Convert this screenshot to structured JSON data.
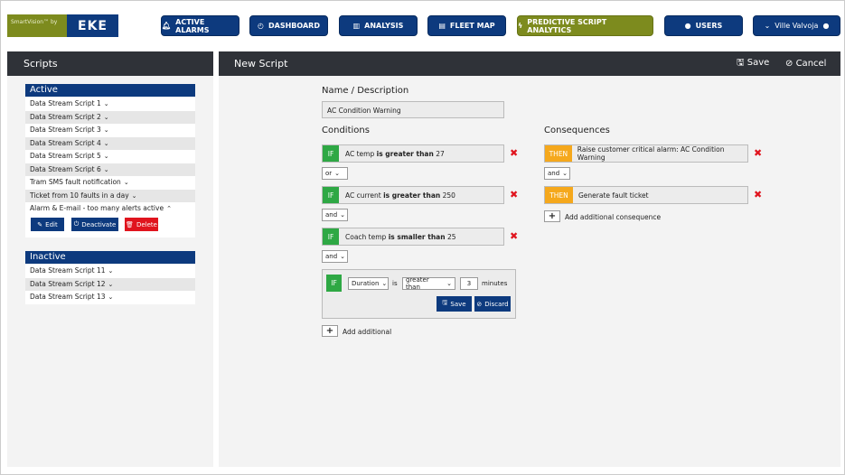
{
  "logo": {
    "brand": "SmartVision™ by",
    "company": "EKE",
    "colors": {
      "olive": "#7d8b1e",
      "blue": "#0d3a7e"
    }
  },
  "nav": [
    {
      "label": "ACTIVE ALARMS",
      "icon": "bell-icon"
    },
    {
      "label": "DASHBOARD",
      "icon": "gauge-icon"
    },
    {
      "label": "ANALYSIS",
      "icon": "bar-chart-icon"
    },
    {
      "label": "FLEET MAP",
      "icon": "map-icon"
    },
    {
      "label": "PREDICTIVE SCRIPT ANALYTICS",
      "icon": "bolt-icon",
      "active": true
    },
    {
      "label": "USERS",
      "icon": "user-icon"
    },
    {
      "label": "Ville Valvoja",
      "icon": "user-icon"
    }
  ],
  "scripts": {
    "title": "Scripts",
    "active_label": "Active",
    "active": [
      "Data Stream Script 1",
      "Data Stream Script 2",
      "Data Stream Script 3",
      "Data Stream Script 4",
      "Data Stream Script 5",
      "Data Stream Script 6",
      "Tram SMS fault notification",
      "Ticket from 10 faults in a day",
      "Alarm & E-mail - too many alerts active"
    ],
    "actions": {
      "edit": "Edit",
      "deactivate": "Deactivate",
      "delete": "Delete"
    },
    "inactive_label": "Inactive",
    "inactive": [
      "Data Stream Script 11",
      "Data Stream Script 12",
      "Data Stream Script 13"
    ]
  },
  "editor": {
    "title": "New Script",
    "save": "Save",
    "cancel": "Cancel",
    "name_label": "Name / Description",
    "name_value": "AC Condition Warning",
    "conditions_label": "Conditions",
    "conditions": [
      {
        "tag": "IF",
        "field": "AC temp",
        "op": "is greater than",
        "value": "27"
      },
      {
        "tag": "IF",
        "field": "AC current",
        "op": "is greater than",
        "value": "250"
      },
      {
        "tag": "IF",
        "field": "Coach temp",
        "op": "is smaller than",
        "value": "25"
      }
    ],
    "connectors": [
      "or",
      "and",
      "and"
    ],
    "new_condition": {
      "tag": "IF",
      "field": "Duration",
      "is": "is",
      "op": "greater than",
      "value": "3",
      "unit": "minutes",
      "save": "Save",
      "discard": "Discard"
    },
    "add_condition": "Add additional",
    "consequences_label": "Consequences",
    "consequences": [
      {
        "tag": "THEN",
        "text": "Raise customer critical alarm: AC Condition Warning"
      },
      {
        "tag": "THEN",
        "text": "Generate fault ticket"
      }
    ],
    "consequence_connector": "and",
    "add_consequence": "Add additional consequence"
  }
}
